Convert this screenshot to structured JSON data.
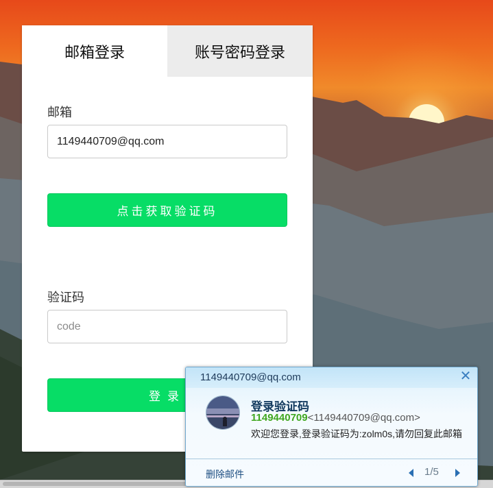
{
  "login": {
    "tabs": [
      {
        "label": "邮箱登录",
        "active": true
      },
      {
        "label": "账号密码登录",
        "active": false
      }
    ],
    "email_label": "邮箱",
    "email_value": "1149440709@qq.com",
    "get_code_button": "点击获取验证码",
    "code_label": "验证码",
    "code_placeholder": "code",
    "code_value": "",
    "login_button": "登录",
    "accent_color": "#07dd66"
  },
  "notification": {
    "account": "1149440709@qq.com",
    "close_icon": "close-icon",
    "subject": "登录验证码",
    "from_name": "1149440709",
    "from_address": "<1149440709@qq.com>",
    "body": "欢迎您登录,登录验证码为:zolm0s,请勿回复此邮箱",
    "delete_label": "删除邮件",
    "pager": "1/5",
    "accent_color": "#3fa71f"
  }
}
